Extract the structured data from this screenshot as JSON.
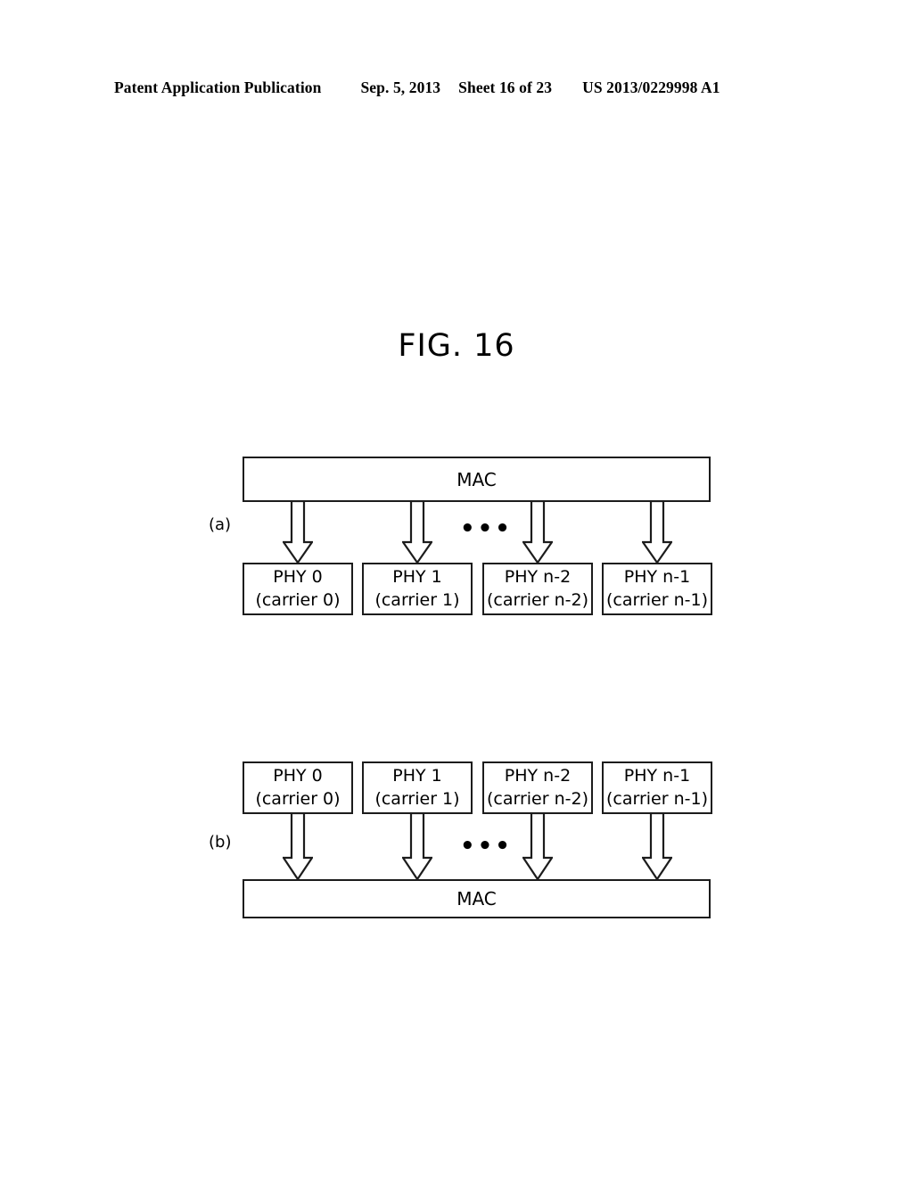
{
  "header": {
    "publication": "Patent Application Publication",
    "date": "Sep. 5, 2013",
    "sheet": "Sheet 16 of 23",
    "patent_number": "US 2013/0229998 A1"
  },
  "figure": {
    "title": "FIG. 16"
  },
  "colors": {
    "ink": "#000000",
    "stroke": "#1c1c1c",
    "background": "#ffffff"
  },
  "panel_a": {
    "label": "(a)",
    "mac": "MAC",
    "ellipsis": "•••",
    "direction": "mac-to-phy",
    "blocks": [
      {
        "title": "PHY 0",
        "subtitle": "(carrier 0)"
      },
      {
        "title": "PHY 1",
        "subtitle": "(carrier 1)"
      },
      {
        "title": "PHY n-2",
        "subtitle": "(carrier n-2)"
      },
      {
        "title": "PHY n-1",
        "subtitle": "(carrier n-1)"
      }
    ]
  },
  "panel_b": {
    "label": "(b)",
    "mac": "MAC",
    "ellipsis": "•••",
    "direction": "phy-to-mac",
    "blocks": [
      {
        "title": "PHY 0",
        "subtitle": "(carrier 0)"
      },
      {
        "title": "PHY 1",
        "subtitle": "(carrier 1)"
      },
      {
        "title": "PHY n-2",
        "subtitle": "(carrier n-2)"
      },
      {
        "title": "PHY n-1",
        "subtitle": "(carrier n-1)"
      }
    ]
  }
}
